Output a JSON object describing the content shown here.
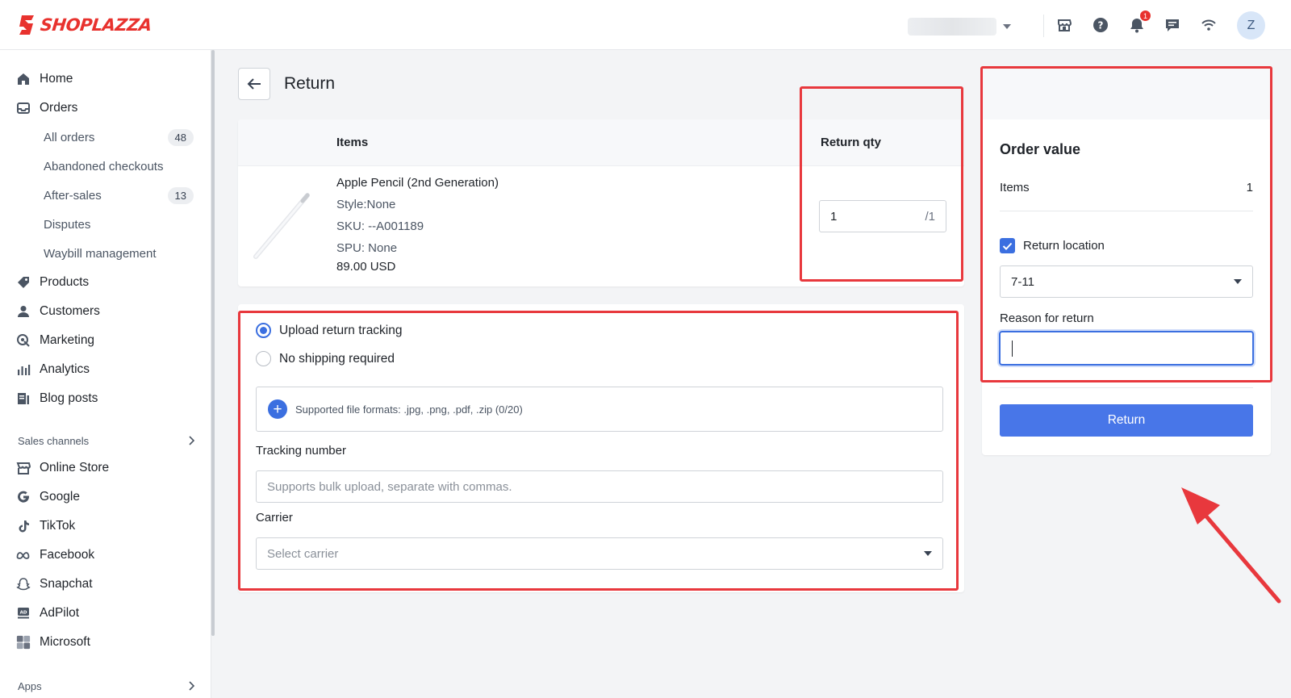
{
  "brand": {
    "name": "SHOPLAZZA",
    "color": "#e8322e"
  },
  "topbar": {
    "notifications_count": "1",
    "avatar_initial": "Z",
    "icons": [
      "store-icon",
      "help-icon",
      "bell-icon",
      "chat-icon",
      "wifi-icon"
    ]
  },
  "sidebar": {
    "items": [
      {
        "label": "Home",
        "icon": "home-icon"
      },
      {
        "label": "Orders",
        "icon": "orders-icon"
      }
    ],
    "orders_sub": [
      {
        "label": "All orders",
        "count": "48"
      },
      {
        "label": "Abandoned checkouts",
        "count": ""
      },
      {
        "label": "After-sales",
        "count": "13"
      },
      {
        "label": "Disputes",
        "count": ""
      },
      {
        "label": "Waybill management",
        "count": ""
      }
    ],
    "main_items": [
      {
        "label": "Products",
        "icon": "tag-icon"
      },
      {
        "label": "Customers",
        "icon": "person-icon"
      },
      {
        "label": "Marketing",
        "icon": "marketing-icon"
      },
      {
        "label": "Analytics",
        "icon": "analytics-icon"
      },
      {
        "label": "Blog posts",
        "icon": "blog-icon"
      }
    ],
    "sales_channels_label": "Sales channels",
    "channels": [
      {
        "label": "Online Store",
        "icon": "store-icon"
      },
      {
        "label": "Google",
        "icon": "google-icon"
      },
      {
        "label": "TikTok",
        "icon": "tiktok-icon"
      },
      {
        "label": "Facebook",
        "icon": "meta-icon"
      },
      {
        "label": "Snapchat",
        "icon": "snapchat-icon"
      },
      {
        "label": "AdPilot",
        "icon": "adpilot-icon"
      },
      {
        "label": "Microsoft",
        "icon": "microsoft-icon"
      }
    ],
    "apps_label": "Apps"
  },
  "page": {
    "title": "Return"
  },
  "items_table": {
    "col_items": "Items",
    "col_return_qty": "Return qty",
    "product": {
      "name": "Apple Pencil (2nd Generation)",
      "style": "Style:None",
      "sku": "SKU: --A001189",
      "spu": "SPU: None",
      "price": "89.00 USD"
    },
    "qty_value": "1",
    "qty_max": "/1"
  },
  "shipping": {
    "option_upload": "Upload return tracking",
    "option_none": "No shipping required",
    "upload_hint": "Supported file formats: .jpg, .png, .pdf, .zip (0/20)",
    "tracking_label": "Tracking number",
    "tracking_placeholder": "Supports bulk upload, separate with commas.",
    "carrier_label": "Carrier",
    "carrier_placeholder": "Select carrier"
  },
  "summary": {
    "title": "Order value",
    "items_label": "Items",
    "items_value": "1",
    "return_location_label": "Return location",
    "return_location_value": "7-11",
    "reason_label": "Reason for return",
    "reason_value": "",
    "return_button": "Return"
  },
  "colors": {
    "accent": "#3b6fe0",
    "annotation": "#e8383d",
    "button": "#4876e8"
  }
}
